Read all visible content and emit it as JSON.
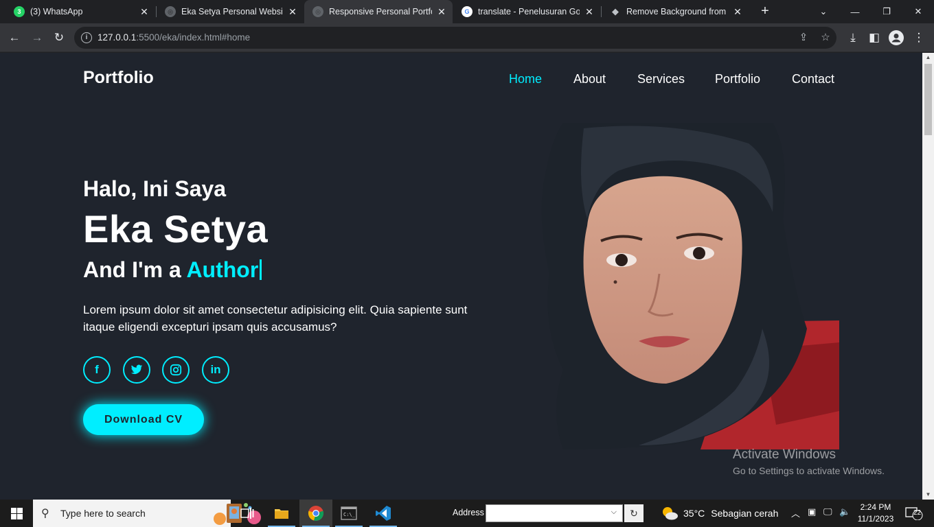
{
  "browser": {
    "tabs": [
      {
        "title": "(3) WhatsApp",
        "icon": "whatsapp-icon"
      },
      {
        "title": "Eka Setya Personal Website",
        "icon": "globe-icon"
      },
      {
        "title": "Responsive Personal Portfolio",
        "icon": "globe-icon"
      },
      {
        "title": "translate - Penelusuran Goog",
        "icon": "google-icon"
      },
      {
        "title": "Remove Background from Im",
        "icon": "layers-icon"
      }
    ],
    "active_tab_index": 2,
    "url_host": "127.0.0.1",
    "url_rest": ":5500/eka/index.html#home"
  },
  "page": {
    "logo": "Portfolio",
    "nav": [
      "Home",
      "About",
      "Services",
      "Portfolio",
      "Contact"
    ],
    "active_nav": "Home",
    "greeting": "Halo, Ini Saya",
    "name": "Eka Setya",
    "role_prefix": "And I'm a",
    "role_word": "Author",
    "description": "Lorem ipsum dolor sit amet consectetur adipisicing elit. Quia sapiente sunt itaque eligendi excepturi ipsam quis accusamus?",
    "socials": [
      "facebook-icon",
      "twitter-icon",
      "instagram-icon",
      "linkedin-icon"
    ],
    "cv_button": "Download CV",
    "accent_color": "#00eeff",
    "background_color": "#1f242d"
  },
  "watermark": {
    "title": "Activate Windows",
    "subtitle": "Go to Settings to activate Windows."
  },
  "taskbar": {
    "search_placeholder": "Type here to search",
    "address_label": "Address",
    "weather_temp": "35°C",
    "weather_text": "Sebagian cerah",
    "time": "2:24 PM",
    "date": "11/1/2023",
    "notification_count": "22"
  }
}
